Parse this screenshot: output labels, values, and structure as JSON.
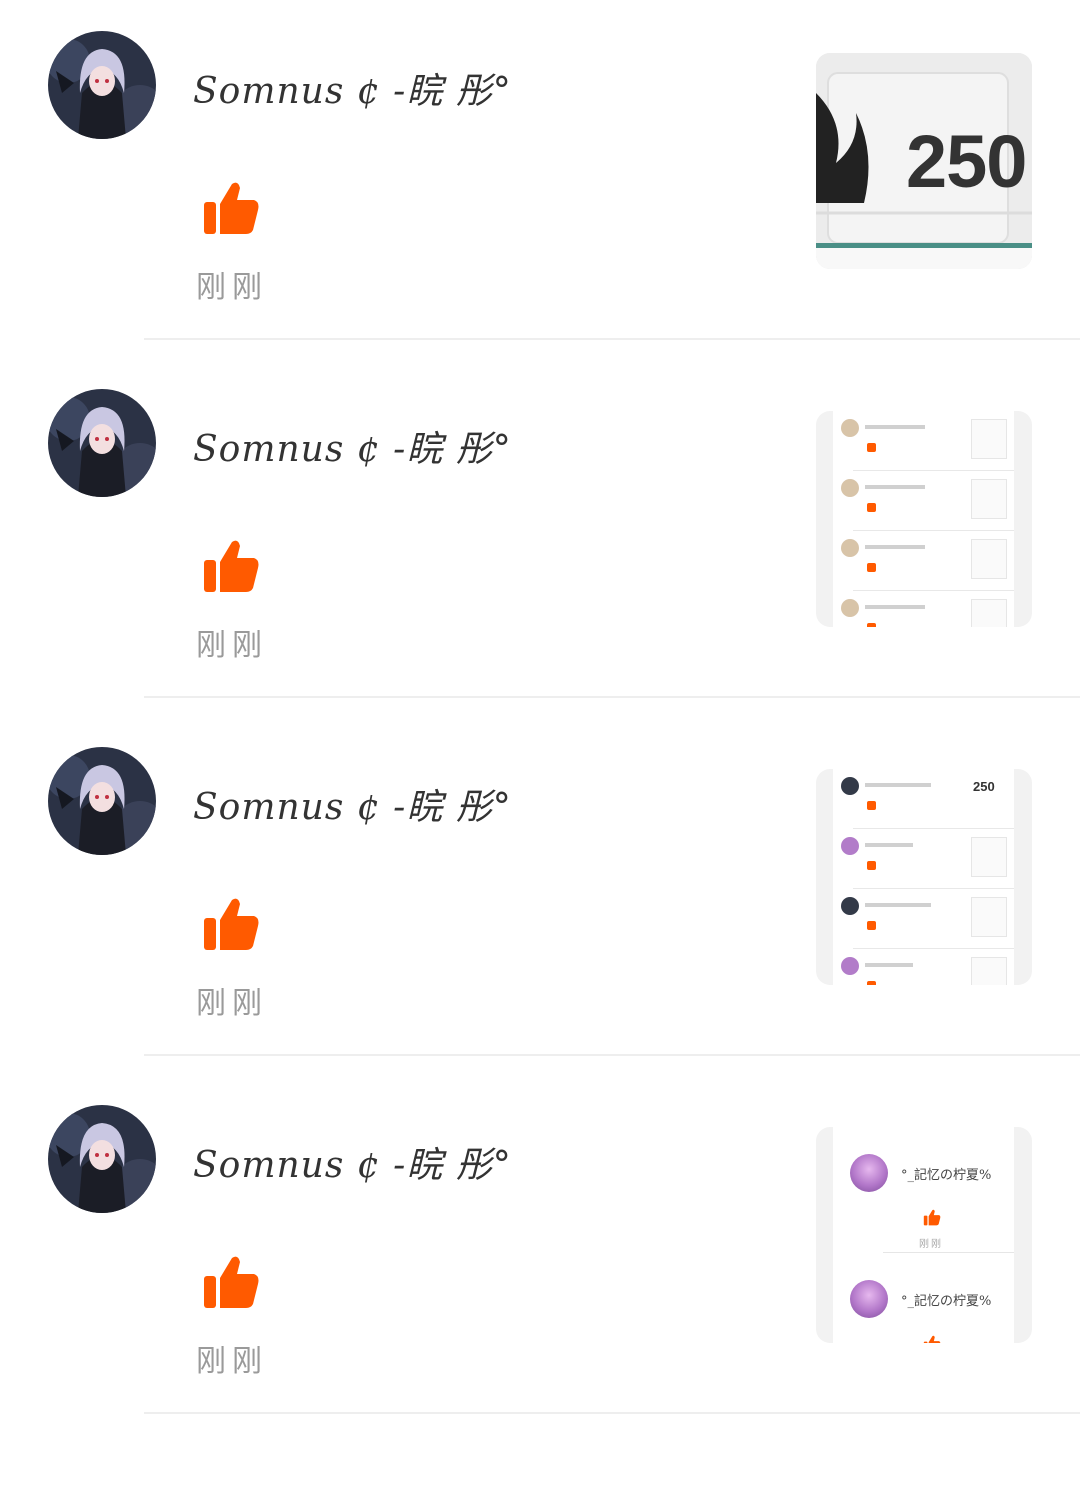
{
  "notifications": [
    {
      "username": "Somnus ¢ -睆 彤°",
      "time": "刚刚",
      "thumbnail": {
        "kind": "badge",
        "badge_value": "250"
      }
    },
    {
      "username": "Somnus ¢ -睆 彤°",
      "time": "刚刚",
      "thumbnail": {
        "kind": "mini-list"
      }
    },
    {
      "username": "Somnus ¢ -睆 彤°",
      "time": "刚刚",
      "thumbnail": {
        "kind": "mini-list",
        "badge_value": "250"
      }
    },
    {
      "username": "Somnus ¢ -睆 彤°",
      "time": "刚刚",
      "thumbnail": {
        "kind": "big-list",
        "rows": [
          {
            "name": "°_記忆の柠夏%",
            "time": "刚刚"
          },
          {
            "name": "°_記忆の柠夏%",
            "time": ""
          }
        ]
      }
    }
  ],
  "colors": {
    "accent": "#ff5a00",
    "divider": "#eeeeee",
    "time_text": "#9a9a9a",
    "name_text": "#333333"
  },
  "icons": {
    "like": "thumbs-up-icon",
    "badge": "flame-icon"
  }
}
